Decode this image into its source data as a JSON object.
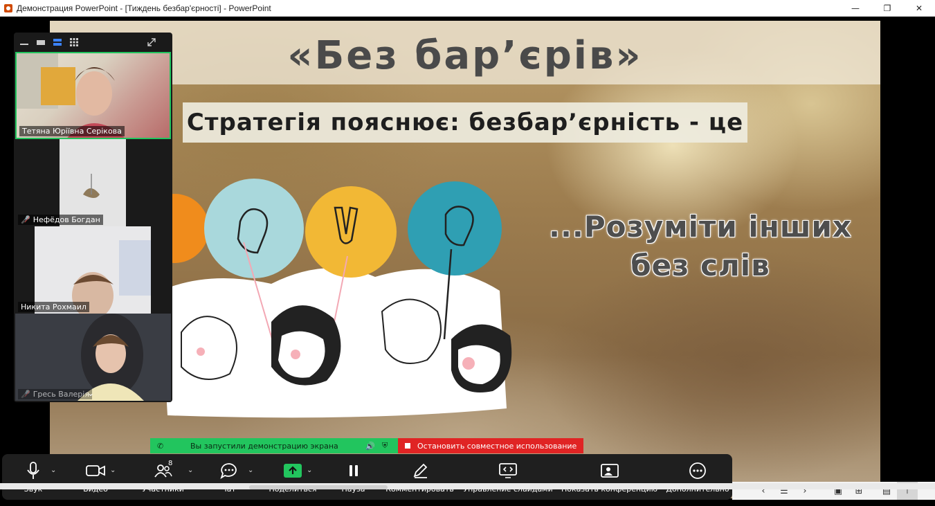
{
  "window": {
    "title": "Демонстрация PowerPoint - [Тиждень безбар'єрності] - PowerPoint",
    "minimize": "—",
    "maximize": "❐",
    "close": "✕"
  },
  "slide": {
    "title": "«Без бар’єрів»",
    "strategy": "Стратегія пояснює: безбар’єрність - це",
    "quote_line1": "...Розуміти інших",
    "quote_line2": "без слів"
  },
  "participants": [
    {
      "name": "Тетяна Юріївна Серікова",
      "muted": false,
      "active": true
    },
    {
      "name": "Нефёдов Богдан",
      "muted": true,
      "active": false
    },
    {
      "name": "Никита Рохмаил",
      "muted": false,
      "active": false
    },
    {
      "name": "Гресь Валерія",
      "muted": true,
      "active": false
    }
  ],
  "share_banner": {
    "status": "Вы запустили демонстрацию экрана",
    "stop": "Остановить совместное использование"
  },
  "toolbar": {
    "audio": "Звук",
    "video": "Видео",
    "participants": "Участники",
    "participants_count": "8",
    "chat": "Чат",
    "share": "Поделиться",
    "pause": "Пауза",
    "annotate": "Комментировать",
    "slide_control": "Управление слайдами",
    "show_meeting": "Показать конференцию",
    "more": "Дополнительно"
  },
  "colors": {
    "share_green": "#22c55e",
    "stop_red": "#e02424",
    "active_speaker": "#22c55e",
    "toolbar_bg": "#1f1f1f"
  }
}
